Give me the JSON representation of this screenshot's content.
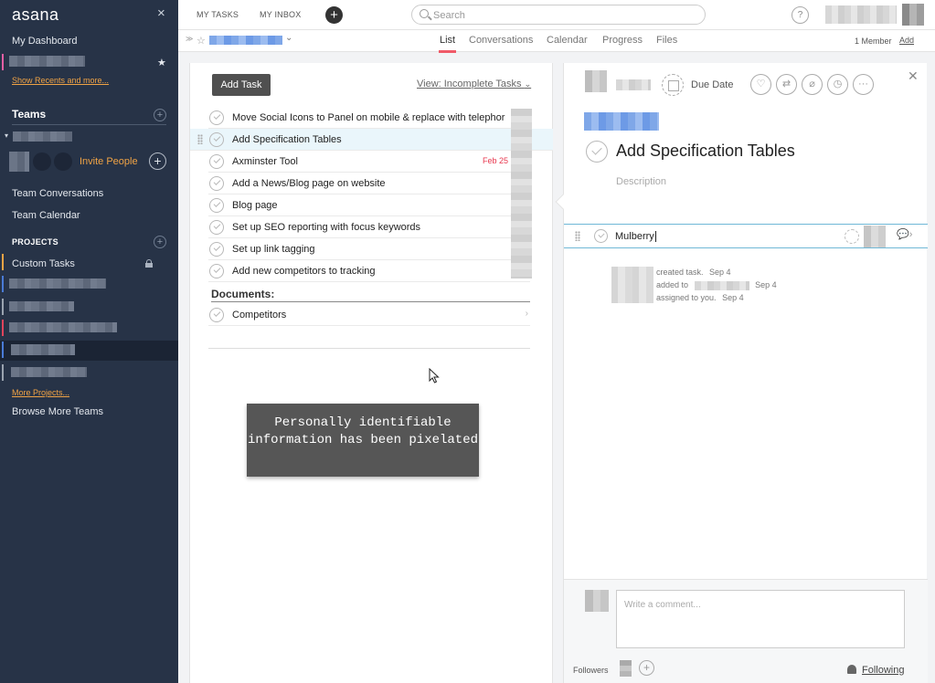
{
  "sidebar": {
    "logo": "asana",
    "close_symbol": "×",
    "my_dashboard": "My Dashboard",
    "show_recents": "Show Recents and more...",
    "teams_heading": "Teams",
    "invite_people": "Invite People",
    "team_conversations": "Team Conversations",
    "team_calendar": "Team Calendar",
    "projects_heading": "PROJECTS",
    "projects": [
      {
        "name": "Custom Tasks",
        "color": "#f0a345"
      }
    ],
    "project_bar_colors": [
      "#4a7bd6",
      "#9aa3af",
      "#e0445c",
      "#4a7bd6",
      "#9aa3af"
    ],
    "more_projects": "More Projects...",
    "browse_teams": "Browse More Teams"
  },
  "topbar": {
    "my_tasks": "MY TASKS",
    "my_inbox": "MY INBOX",
    "search_placeholder": "Search",
    "help": "?"
  },
  "subbar": {
    "tabs": [
      "List",
      "Conversations",
      "Calendar",
      "Progress",
      "Files"
    ],
    "active_tab": "List",
    "member_count": "1 Member",
    "add": "Add"
  },
  "list": {
    "add_task": "Add Task",
    "view_filter": "View: Incomplete Tasks",
    "tasks": [
      {
        "name": "Move Social Icons to Panel on mobile & replace with telephor",
        "due": ""
      },
      {
        "name": "Add Specification Tables",
        "due": "",
        "selected": true
      },
      {
        "name": "Axminster Tool",
        "due": "Feb 25"
      },
      {
        "name": "Add a News/Blog page on website",
        "due": ""
      },
      {
        "name": "Blog page",
        "due": ""
      },
      {
        "name": "Set up SEO reporting with focus keywords",
        "due": ""
      },
      {
        "name": "Set up link tagging",
        "due": ""
      },
      {
        "name": "Add new competitors to tracking",
        "due": ""
      }
    ],
    "section_heading": "Documents:",
    "section_tasks": [
      {
        "name": "Competitors"
      }
    ]
  },
  "notice": "Personally identifiable information has been pixelated",
  "detail": {
    "due_date": "Due Date",
    "title": "Add Specification Tables",
    "description_placeholder": "Description",
    "subtask_value": "Mulberry",
    "stories": [
      {
        "action": "created task.",
        "date": "Sep 4"
      },
      {
        "action": "added to",
        "date": "Sep 4"
      },
      {
        "action": "assigned to you.",
        "date": "Sep 4"
      }
    ],
    "comment_placeholder": "Write a comment...",
    "followers_label": "Followers",
    "following": "Following"
  },
  "colors": {
    "sidebar_bg": "#273347",
    "accent_orange": "#f0a345",
    "tab_underline": "#f05a68",
    "due_red": "#e8384f"
  }
}
